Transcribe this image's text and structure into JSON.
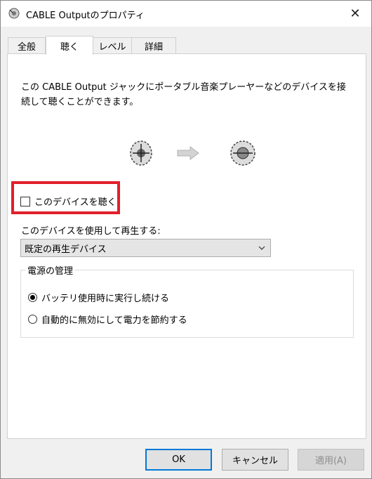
{
  "window": {
    "title": "CABLE Outputのプロパティ",
    "close_glyph": "✕"
  },
  "tabs": [
    {
      "label": "全般",
      "active": false
    },
    {
      "label": "聴く",
      "active": true
    },
    {
      "label": "レベル",
      "active": false
    },
    {
      "label": "詳細",
      "active": false
    }
  ],
  "listen": {
    "description": "この CABLE Output ジャックにポータブル音楽プレーヤーなどのデバイスを接続して聴くことができます。",
    "checkbox_label": "このデバイスを聴く",
    "checkbox_checked": false,
    "playback_label": "このデバイスを使用して再生する:",
    "playback_selected": "既定の再生デバイス"
  },
  "power": {
    "legend": "電源の管理",
    "options": [
      {
        "label": "バッテリ使用時に実行し続ける",
        "checked": true
      },
      {
        "label": "自動的に無効にして電力を節約する",
        "checked": false
      }
    ]
  },
  "buttons": {
    "ok": "OK",
    "cancel": "キャンセル",
    "apply": "適用(A)"
  },
  "colors": {
    "highlight": "#e0202a",
    "default_button_border": "#0078d7"
  },
  "icons": [
    "speaker-icon",
    "close-icon",
    "jack-icon",
    "arrow-right-icon",
    "chevron-down-icon"
  ]
}
